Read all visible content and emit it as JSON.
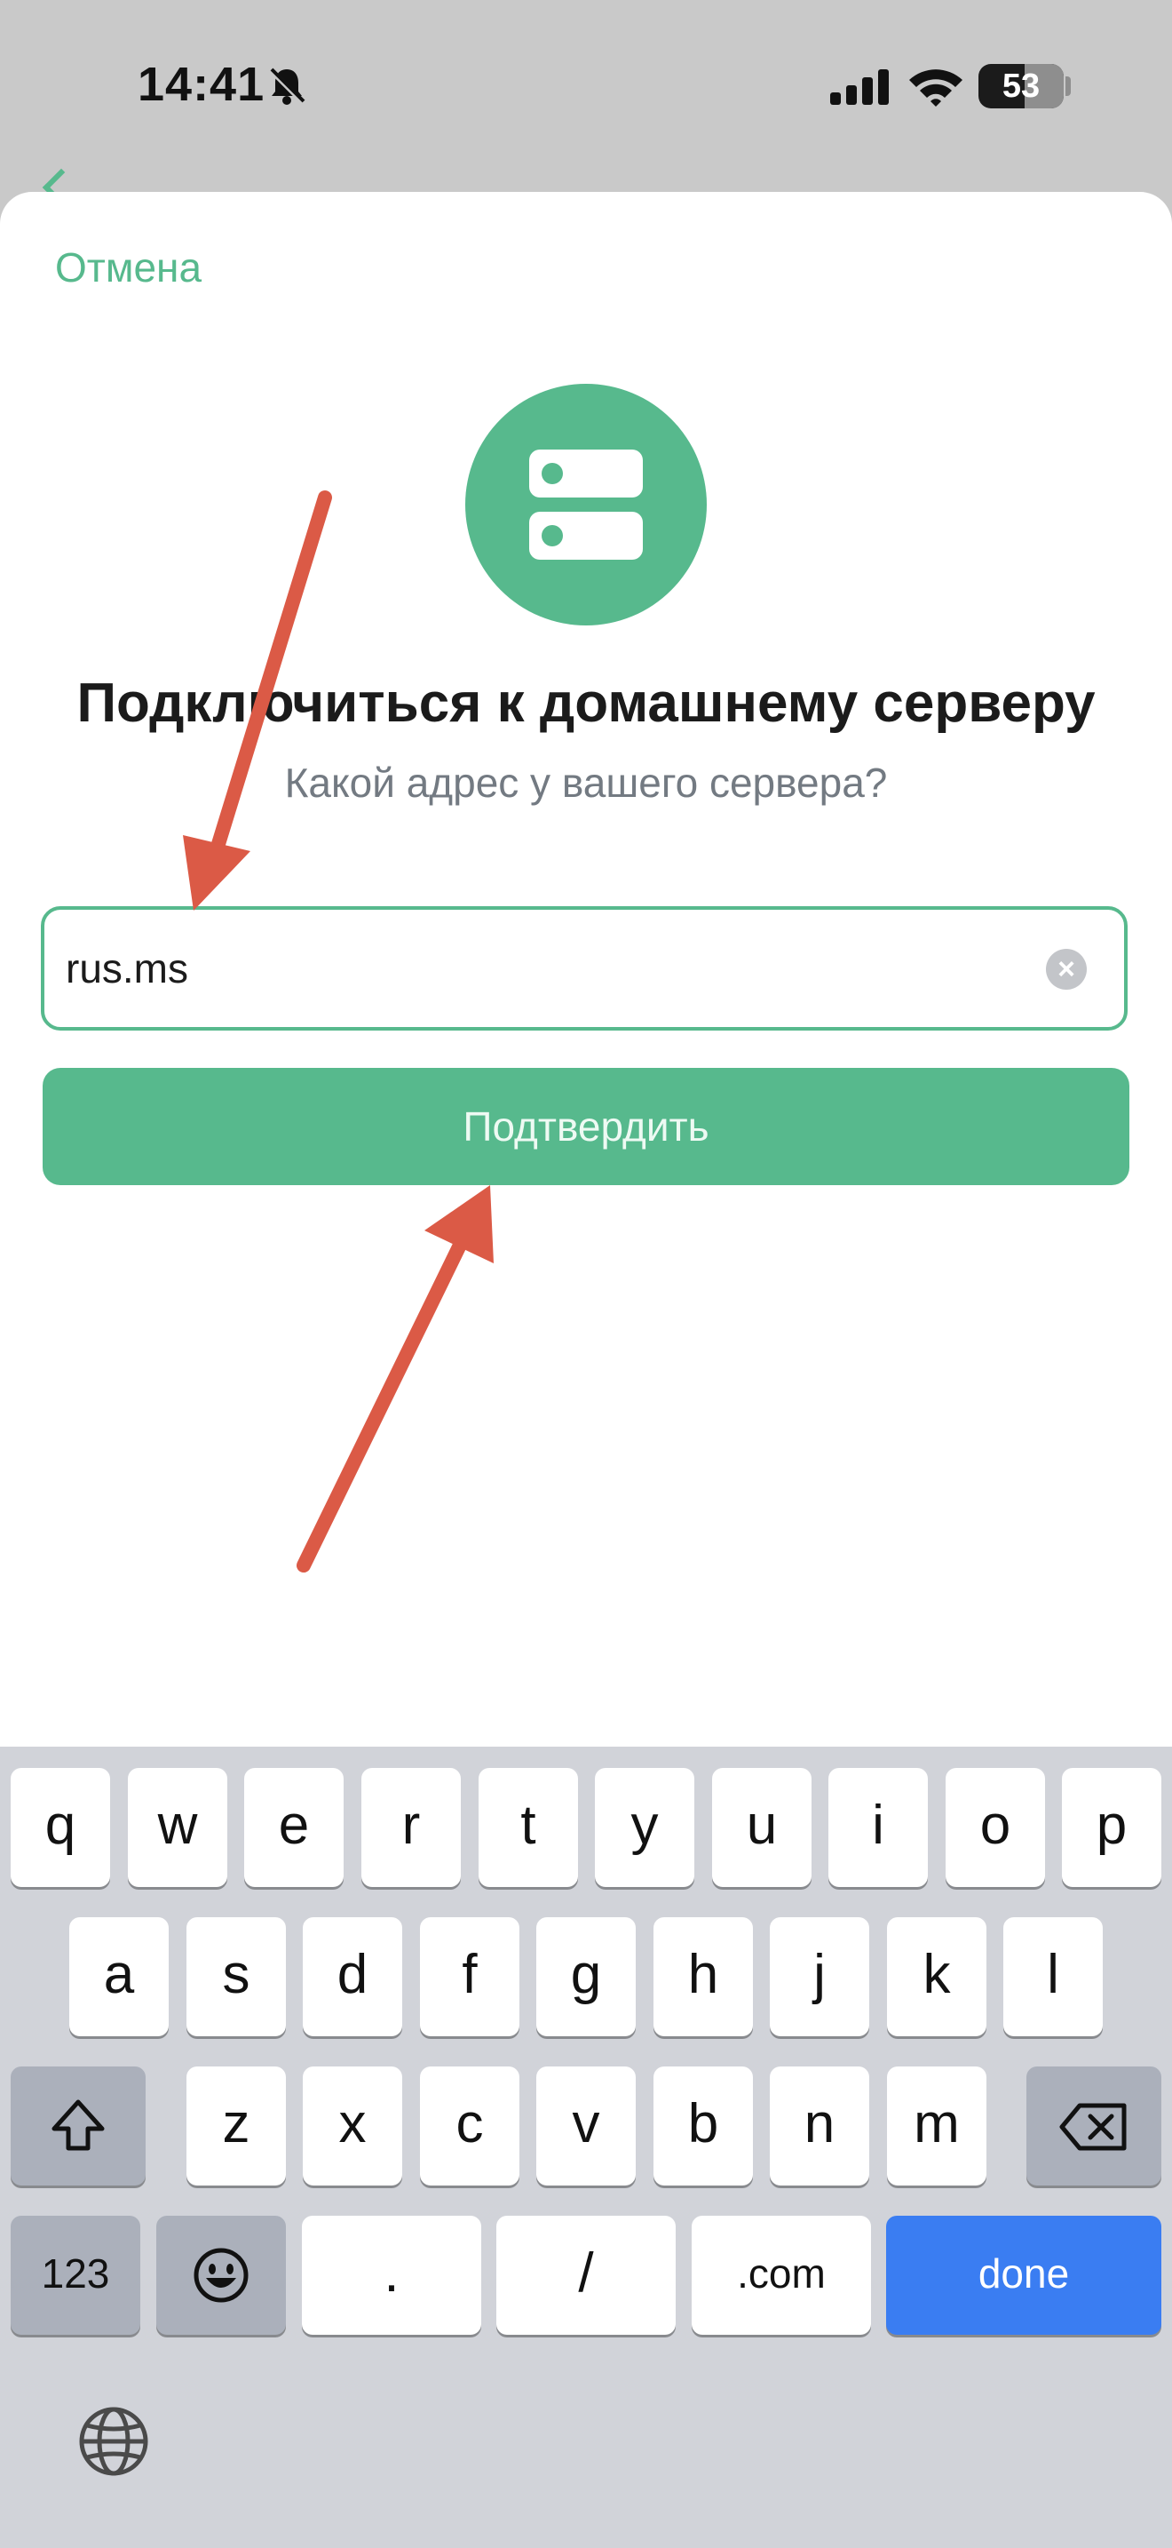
{
  "status_bar": {
    "time": "14:41",
    "battery_level": "53",
    "icons": [
      "bell-slash-icon",
      "signal-icon",
      "wifi-icon",
      "battery-icon"
    ]
  },
  "sheet": {
    "cancel_label": "Отмена",
    "icon": "server-icon",
    "title": "Подключиться к домашнему серверу",
    "subtitle": "Какой адрес у вашего сервера?",
    "server_field": {
      "value": "rus.ms"
    },
    "confirm_label": "Подтвердить"
  },
  "colors": {
    "accent": "#57b98d",
    "annotation_arrow": "#db5a46",
    "keyboard_done": "#3a7df2"
  },
  "keyboard": {
    "row1": [
      "q",
      "w",
      "e",
      "r",
      "t",
      "y",
      "u",
      "i",
      "o",
      "p"
    ],
    "row2": [
      "a",
      "s",
      "d",
      "f",
      "g",
      "h",
      "j",
      "k",
      "l"
    ],
    "row3": [
      "z",
      "x",
      "c",
      "v",
      "b",
      "n",
      "m"
    ],
    "row4": {
      "numbers": "123",
      "dot": ".",
      "slash": "/",
      "com": ".com",
      "done": "done"
    },
    "icons": [
      "shift-icon",
      "backspace-icon",
      "emoji-icon",
      "globe-icon"
    ]
  }
}
